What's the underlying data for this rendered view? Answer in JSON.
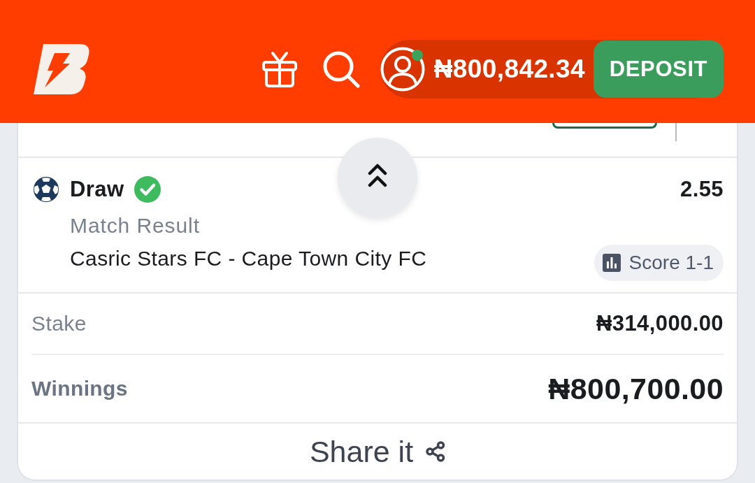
{
  "header": {
    "balance": "₦800,842.34",
    "deposit_button": "DEPOSIT",
    "online": true
  },
  "selection": {
    "pick": "Draw",
    "won": true,
    "odds": "2.55",
    "market": "Match Result",
    "match": "Casric Stars FC - Cape Town City FC",
    "score_button": "Score 1-1"
  },
  "summary": [
    {
      "kind": "normal",
      "label": "Stake",
      "value": "₦314,000.00"
    },
    {
      "kind": "total",
      "label": "Winnings",
      "value": "₦800,700.00"
    }
  ],
  "share_button": "Share it"
}
